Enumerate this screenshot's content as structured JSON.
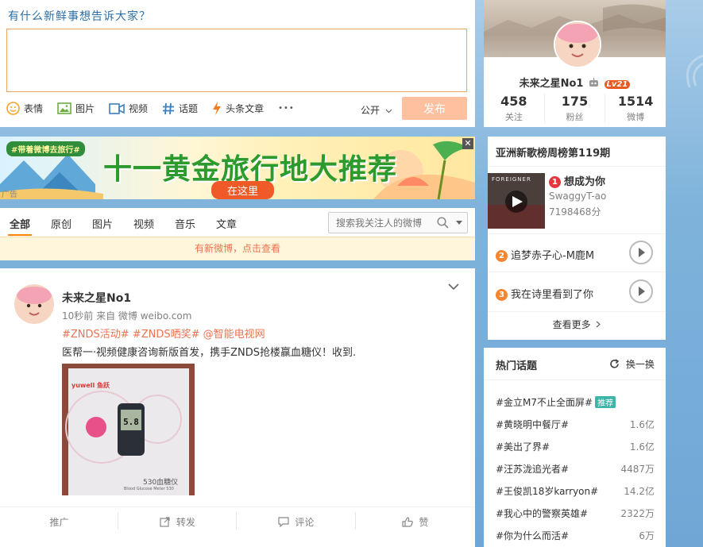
{
  "composer": {
    "prompt": "有什么新鲜事想告诉大家？",
    "value": "",
    "tools": [
      {
        "icon": "smiley-icon",
        "label": "表情"
      },
      {
        "icon": "image-icon",
        "label": "图片"
      },
      {
        "icon": "video-icon",
        "label": "视频"
      },
      {
        "icon": "hashtag-icon",
        "label": "话题"
      },
      {
        "icon": "lightning-icon",
        "label": "头条文章"
      },
      {
        "icon": "more-icon",
        "label": "•••"
      }
    ],
    "visibility": "公开",
    "publish_label": "发布"
  },
  "banner": {
    "hashtag": "#带着微博去旅行#",
    "headline": "十一黄金旅行地大推荐",
    "cta": "在这里",
    "ad_label": "广告",
    "close": "✕"
  },
  "tabs": {
    "items": [
      "全部",
      "原创",
      "图片",
      "视频",
      "音乐",
      "文章"
    ],
    "search_placeholder": "搜索我关注人的微博"
  },
  "notice": "有新微博，点击查看",
  "post": {
    "author": "未来之星No1",
    "meta": "10秒前 来自 微博 weibo.com",
    "tags": "#ZNDS活动# #ZNDS晒奖# @智能电视网",
    "text": "医帮一·视频健康咨询新版首发，携手ZNDS抢楼赢血糖仪！收到.",
    "image_brand": "yuwell 鱼跃",
    "image_reading": "5.8",
    "image_caption": "530血糖仪",
    "image_sub": "Blood Glucose Meter 530",
    "actions": [
      "推广",
      "转发",
      "评论",
      "赞"
    ]
  },
  "profile": {
    "name": "未来之星No1",
    "level": "Lv21",
    "stats": [
      {
        "value": "458",
        "label": "关注"
      },
      {
        "value": "175",
        "label": "粉丝"
      },
      {
        "value": "1514",
        "label": "微博"
      }
    ]
  },
  "chart": {
    "title": "亚洲新歌榜周榜第119期",
    "top": {
      "rank": "1",
      "song": "想成为你",
      "artist": "SwaggyT-ao",
      "score": "7198468分",
      "cover_text": "FOREIGNER"
    },
    "rows": [
      {
        "rank": "2",
        "song": "追梦赤子心-M鹿M"
      },
      {
        "rank": "3",
        "song": "我在诗里看到了你"
      }
    ],
    "more": "查看更多",
    "colors": {
      "rank1": "#e5363d",
      "rank2": "#f58631",
      "rank3": "#f58631"
    }
  },
  "topics": {
    "title": "热门话题",
    "refresh": "换一换",
    "items": [
      {
        "name": "#金立M7不止全面屏#",
        "count": "",
        "badge": "推荐"
      },
      {
        "name": "#黄晓明中餐厅#",
        "count": "1.6亿",
        "badge": ""
      },
      {
        "name": "#美出了界#",
        "count": "1.6亿",
        "badge": ""
      },
      {
        "name": "#汪苏泷追光者#",
        "count": "4487万",
        "badge": ""
      },
      {
        "name": "#王俊凯18岁karryon#",
        "count": "14.2亿",
        "badge": ""
      },
      {
        "name": "#我心中的警察英雄#",
        "count": "2322万",
        "badge": ""
      },
      {
        "name": "#你为什么而活#",
        "count": "6万",
        "badge": ""
      }
    ]
  }
}
